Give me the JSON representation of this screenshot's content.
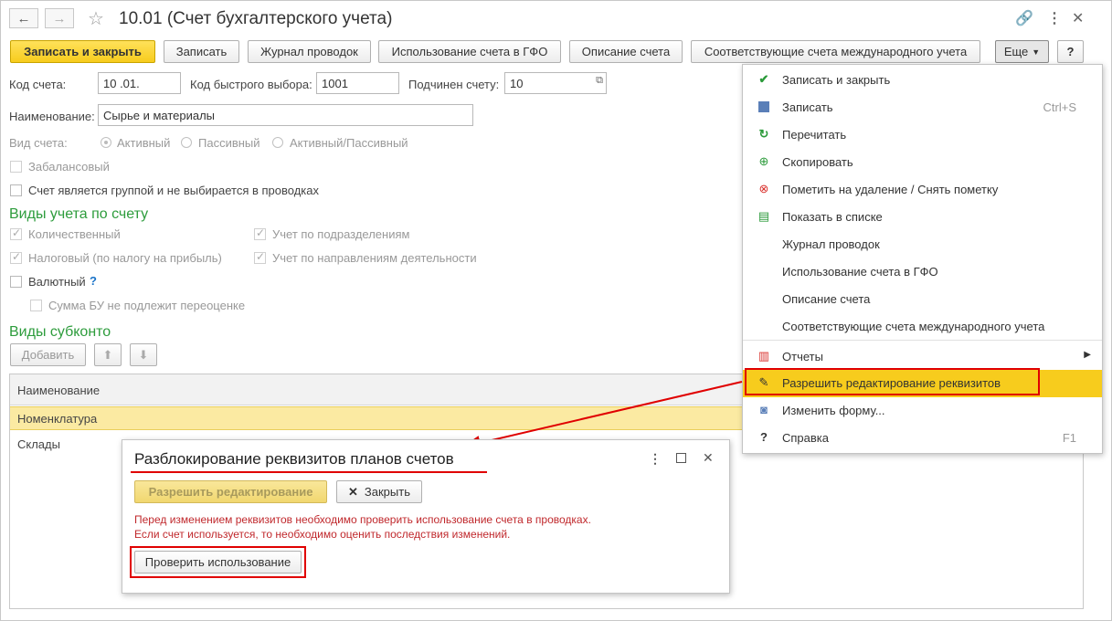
{
  "window": {
    "title": "10.01 (Счет бухгалтерского учета)",
    "nav_back": "←",
    "nav_forward": "→"
  },
  "toolbar": {
    "save_close": "Записать и закрыть",
    "save": "Записать",
    "journal": "Журнал проводок",
    "gfo_usage": "Использование счета в ГФО",
    "description": "Описание счета",
    "intl_accounts": "Соответствующие счета международного учета",
    "more": "Еще",
    "help": "?"
  },
  "form": {
    "code_label": "Код счета:",
    "code_value": "10 .01.",
    "quick_code_label": "Код быстрого выбора:",
    "quick_code_value": "1001",
    "parent_label": "Подчинен счету:",
    "parent_value": "10",
    "name_label": "Наименование:",
    "name_value": "Сырье и материалы",
    "type_label": "Вид счета:",
    "type_options": [
      "Активный",
      "Пассивный",
      "Активный/Пассивный"
    ],
    "offbalance_label": "Забалансовый",
    "group_label": "Счет является группой и не выбирается в проводках",
    "accounting_section": "Виды учета по счету",
    "quantitative": "Количественный",
    "by_departments": "Учет по подразделениям",
    "tax": "Налоговый (по налогу на прибыль)",
    "by_activities": "Учет по направлениям деятельности",
    "currency": "Валютный",
    "currency_help": "?",
    "no_revaluation": "Сумма БУ не подлежит переоценке",
    "subconto_section": "Виды субконто",
    "add_button": "Добавить"
  },
  "table": {
    "header": "Наименование",
    "rows": [
      "Номенклатура",
      "Склады"
    ]
  },
  "menu": {
    "items": [
      {
        "label": "Записать и закрыть",
        "shortcut": "",
        "icon": "save-close-icon"
      },
      {
        "label": "Записать",
        "shortcut": "Ctrl+S",
        "icon": "floppy-icon"
      },
      {
        "label": "Перечитать",
        "shortcut": "",
        "icon": "refresh-icon"
      },
      {
        "label": "Скопировать",
        "shortcut": "",
        "icon": "copy-icon"
      },
      {
        "label": "Пометить на удаление / Снять пометку",
        "shortcut": "",
        "icon": "delete-mark-icon"
      },
      {
        "label": "Показать в списке",
        "shortcut": "",
        "icon": "show-in-list-icon"
      },
      {
        "label": "Журнал проводок",
        "shortcut": "",
        "icon": ""
      },
      {
        "label": "Использование счета в ГФО",
        "shortcut": "",
        "icon": ""
      },
      {
        "label": "Описание счета",
        "shortcut": "",
        "icon": ""
      },
      {
        "label": "Соответствующие счета международного учета",
        "shortcut": "",
        "icon": ""
      },
      {
        "label": "Отчеты",
        "shortcut": "",
        "icon": "reports-icon"
      },
      {
        "label": "Разрешить редактирование реквизитов",
        "shortcut": "",
        "icon": "edit-pencil-icon"
      },
      {
        "label": "Изменить форму...",
        "shortcut": "",
        "icon": "change-form-icon"
      },
      {
        "label": "Справка",
        "shortcut": "F1",
        "icon": "help-icon"
      }
    ]
  },
  "dialog": {
    "title": "Разблокирование реквизитов планов счетов",
    "allow_button": "Разрешить редактирование",
    "close_button": "Закрыть",
    "warning_line1": "Перед изменением реквизитов необходимо проверить использование счета в проводках.",
    "warning_line2": "Если счет используется, то необходимо оценить последствия изменений.",
    "check_button": "Проверить использование"
  },
  "colors": {
    "accent_yellow": "#f7cc1d",
    "section_green": "#2d9c3c",
    "warning_red": "#c0282c",
    "highlight_red": "#e00000"
  }
}
